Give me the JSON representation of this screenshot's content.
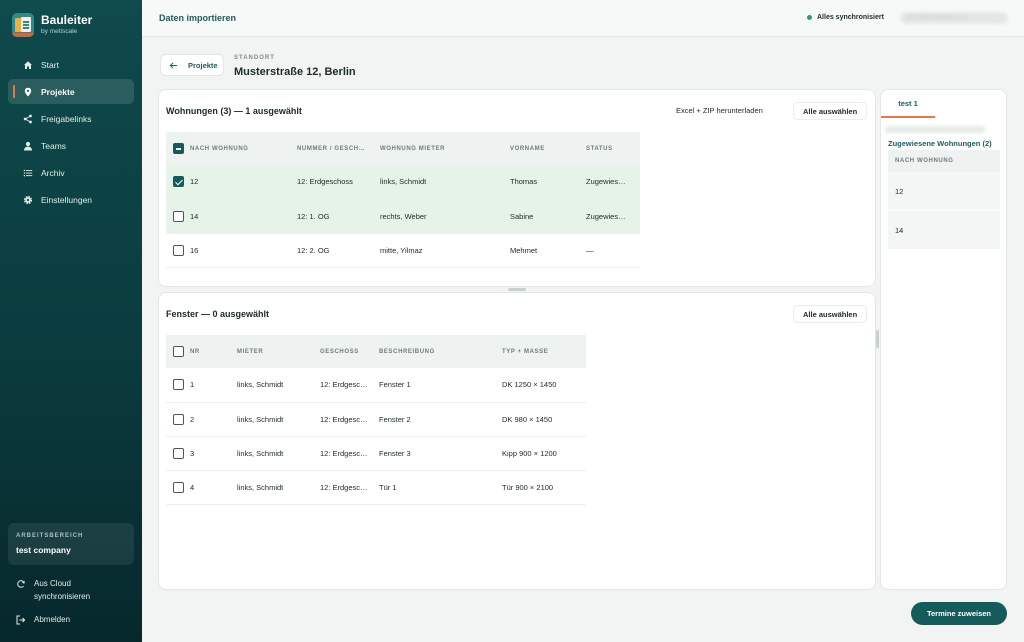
{
  "brand": {
    "name": "Bauleiter",
    "sub": "by metiscale"
  },
  "nav": [
    {
      "id": "start",
      "label": "Start",
      "icon": "home-icon"
    },
    {
      "id": "projekte",
      "label": "Projekte",
      "icon": "location-pin-icon",
      "active": true
    },
    {
      "id": "freigabelinks",
      "label": "Freigabelinks",
      "icon": "share-icon"
    },
    {
      "id": "teams",
      "label": "Teams",
      "icon": "person-icon"
    },
    {
      "id": "archiv",
      "label": "Archiv",
      "icon": "list-icon"
    },
    {
      "id": "einstellungen",
      "label": "Einstellungen",
      "icon": "gear-icon"
    }
  ],
  "workspace": {
    "label": "ARBEITSBEREICH",
    "name": "test company"
  },
  "bottom_actions": {
    "sync_line1": "Aus Cloud",
    "sync_line2": "synchronisieren",
    "logout": "Abmelden"
  },
  "topbar": {
    "title": "Daten importieren",
    "sync_status": "Alles synchronisiert",
    "user_email": "user@example.com"
  },
  "header": {
    "back_label": "Projekte",
    "location_label": "STANDORT",
    "location_title": "Musterstraße 12, Berlin"
  },
  "wohnungen": {
    "title": "Wohnungen (3) — 1 ausgewählt",
    "export_label": "Excel + ZIP herunterladen",
    "select_all_label": "Alle auswählen",
    "columns": [
      "NACH WOHNUNG",
      "NUMMER / GESCH…",
      "WOHNUNG MIETER",
      "VORNAME",
      "STATUS"
    ],
    "rows": [
      {
        "nr": "12",
        "nummer": "12: Erdgeschoss",
        "mieter": "links, Schmidt",
        "vorname": "Thomas",
        "status": "Zugewies…",
        "checked": true,
        "highlighted": true
      },
      {
        "nr": "14",
        "nummer": "12: 1. OG",
        "mieter": "rechts, Weber",
        "vorname": "Sabine",
        "status": "Zugewies…",
        "checked": false,
        "highlighted": true
      },
      {
        "nr": "16",
        "nummer": "12: 2. OG",
        "mieter": "mitte, Yilmaz",
        "vorname": "Mehmet",
        "status": "—",
        "checked": false,
        "highlighted": false
      }
    ]
  },
  "fenster": {
    "title": "Fenster — 0 ausgewählt",
    "select_all_label": "Alle auswählen",
    "columns": [
      "NR",
      "MIETER",
      "GESCHOSS",
      "BESCHREIBUNG",
      "TYP + MASSE"
    ],
    "rows": [
      {
        "nr": "1",
        "mieter": "links, Schmidt",
        "geschoss": "12: Erdgesc…",
        "beschreibung": "Fenster 1",
        "typ": "DK 1250 × 1450"
      },
      {
        "nr": "2",
        "mieter": "links, Schmidt",
        "geschoss": "12: Erdgesc…",
        "beschreibung": "Fenster 2",
        "typ": "DK 980 × 1450"
      },
      {
        "nr": "3",
        "mieter": "links, Schmidt",
        "geschoss": "12: Erdgesc…",
        "beschreibung": "Fenster 3",
        "typ": "Kipp 900 × 1200"
      },
      {
        "nr": "4",
        "mieter": "links, Schmidt",
        "geschoss": "12: Erdgesc…",
        "beschreibung": "Tür 1",
        "typ": "Tür 900 × 2100"
      }
    ]
  },
  "right_panel": {
    "tab_label": "test 1",
    "blurred_text": "user@example.com",
    "heading": "Zugewiesene Wohnungen (2)",
    "column": "NACH WOHNUNG",
    "items": [
      "12",
      "14"
    ]
  },
  "primary_action": "Termine zuweisen",
  "colors": {
    "sidebar": "#0f4a4c",
    "accent": "#e07a4d",
    "primary": "#155b5b",
    "selected_row": "#e6f3e8"
  }
}
